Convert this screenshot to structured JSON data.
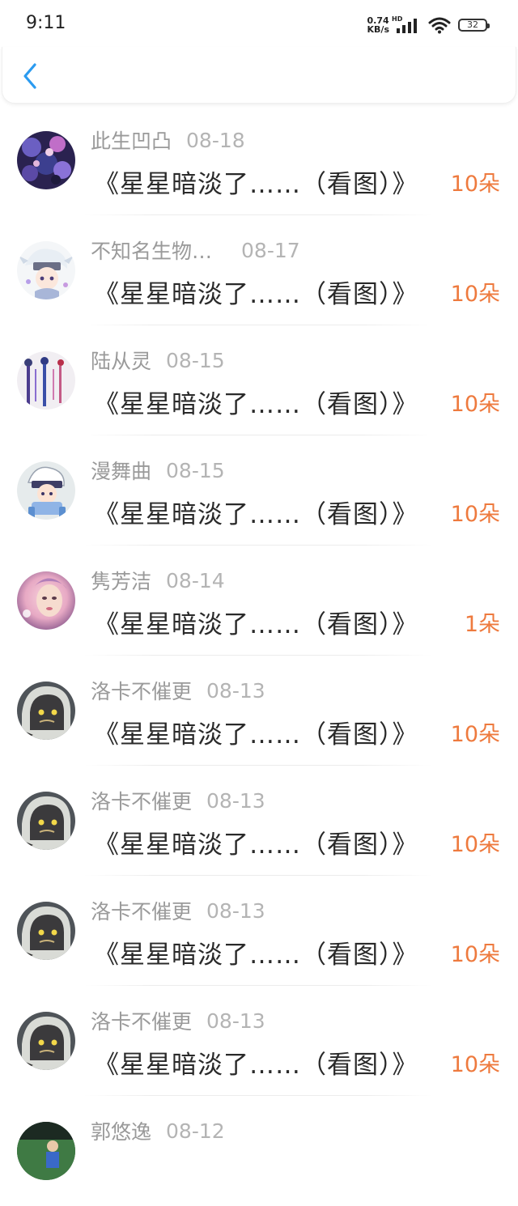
{
  "status_bar": {
    "time": "9:11",
    "net_speed_value": "0.74",
    "net_speed_unit": "KB/s",
    "network_type": "HD",
    "battery_level": "32"
  },
  "header": {
    "back_icon": "chevron-left-icon",
    "accent_color": "#2b9bf0"
  },
  "colors": {
    "flower_count": "#ee7a3e",
    "name": "#9a9a9a",
    "date": "#b4b4b4",
    "title": "#2a2a2a"
  },
  "items": [
    {
      "name": "此生凹凸",
      "date": "08-18",
      "title": "《星星暗淡了……（看图）》",
      "count": "10朵",
      "avatar": "dark-purple-collage"
    },
    {
      "name": "不知名生物…",
      "date": "08-17",
      "title": "《星星暗淡了……（看图）》",
      "count": "10朵",
      "avatar": "white-haired-chibi"
    },
    {
      "name": "陆从灵",
      "date": "08-15",
      "title": "《星星暗淡了……（看图）》",
      "count": "10朵",
      "avatar": "tassel-ornaments"
    },
    {
      "name": "漫舞曲",
      "date": "08-15",
      "title": "《星星暗淡了……（看图）》",
      "count": "10朵",
      "avatar": "chibi-in-chair"
    },
    {
      "name": "隽芳洁",
      "date": "08-14",
      "title": "《星星暗淡了……（看图）》",
      "count": "1朵",
      "avatar": "pink-doll-face"
    },
    {
      "name": "洛卡不催更",
      "date": "08-13",
      "title": "《星星暗淡了……（看图）》",
      "count": "10朵",
      "avatar": "hooded-character"
    },
    {
      "name": "洛卡不催更",
      "date": "08-13",
      "title": "《星星暗淡了……（看图）》",
      "count": "10朵",
      "avatar": "hooded-character"
    },
    {
      "name": "洛卡不催更",
      "date": "08-13",
      "title": "《星星暗淡了……（看图）》",
      "count": "10朵",
      "avatar": "hooded-character"
    },
    {
      "name": "洛卡不催更",
      "date": "08-13",
      "title": "《星星暗淡了……（看图）》",
      "count": "10朵",
      "avatar": "hooded-character"
    },
    {
      "name": "郭悠逸",
      "date": "08-12",
      "title": "",
      "count": "",
      "avatar": "green-field-photo"
    }
  ]
}
